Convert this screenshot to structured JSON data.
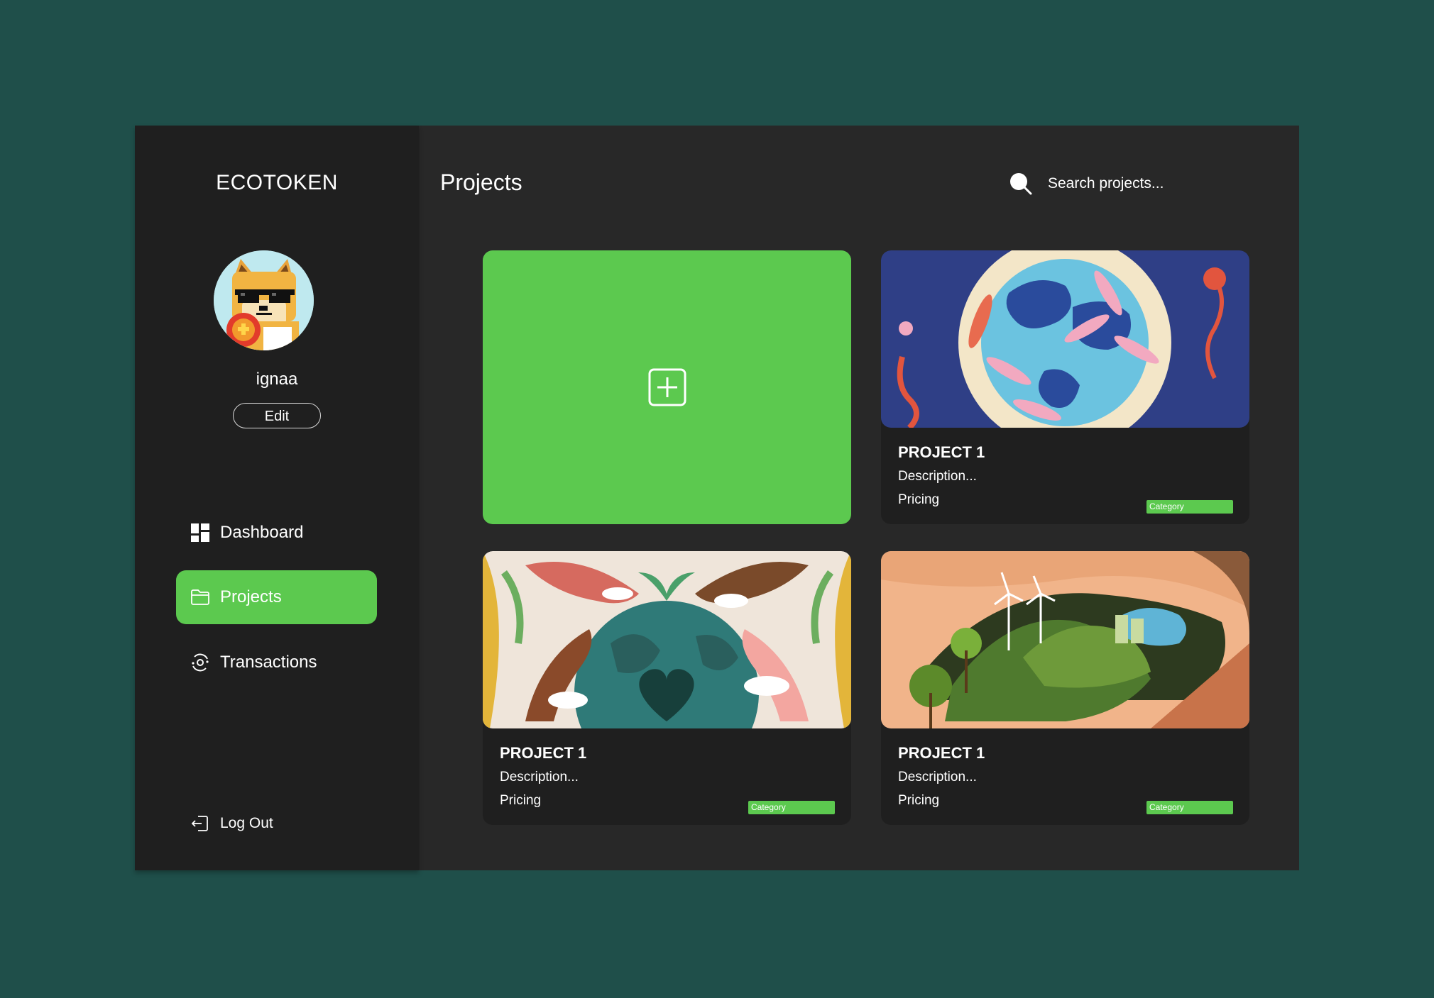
{
  "brand": "ECOTOKEN",
  "profile": {
    "username": "ignaa",
    "edit_label": "Edit",
    "avatar_icon": "doge-avatar-icon"
  },
  "nav": {
    "dashboard": "Dashboard",
    "projects": "Projects",
    "transactions": "Transactions",
    "logout": "Log Out",
    "active": "Projects"
  },
  "header": {
    "title": "Projects",
    "search_placeholder": "Search projects..."
  },
  "add_card": {
    "icon": "plus-square-icon"
  },
  "projects": [
    {
      "title": "PROJECT 1",
      "description": "Description...",
      "pricing": "Pricing",
      "category": "Category",
      "image": "ocean-globe-illustration"
    },
    {
      "title": "PROJECT 1",
      "description": "Description...",
      "pricing": "Pricing",
      "category": "Category",
      "image": "earth-hands-heart-illustration"
    },
    {
      "title": "PROJECT 1",
      "description": "Description...",
      "pricing": "Pricing",
      "category": "Category",
      "image": "wind-turbine-hills-illustration"
    }
  ],
  "colors": {
    "background": "#1f4f4a",
    "panel": "#282828",
    "sidebar": "#1f1f1f",
    "accent": "#5cc94f",
    "text": "#ffffff"
  }
}
